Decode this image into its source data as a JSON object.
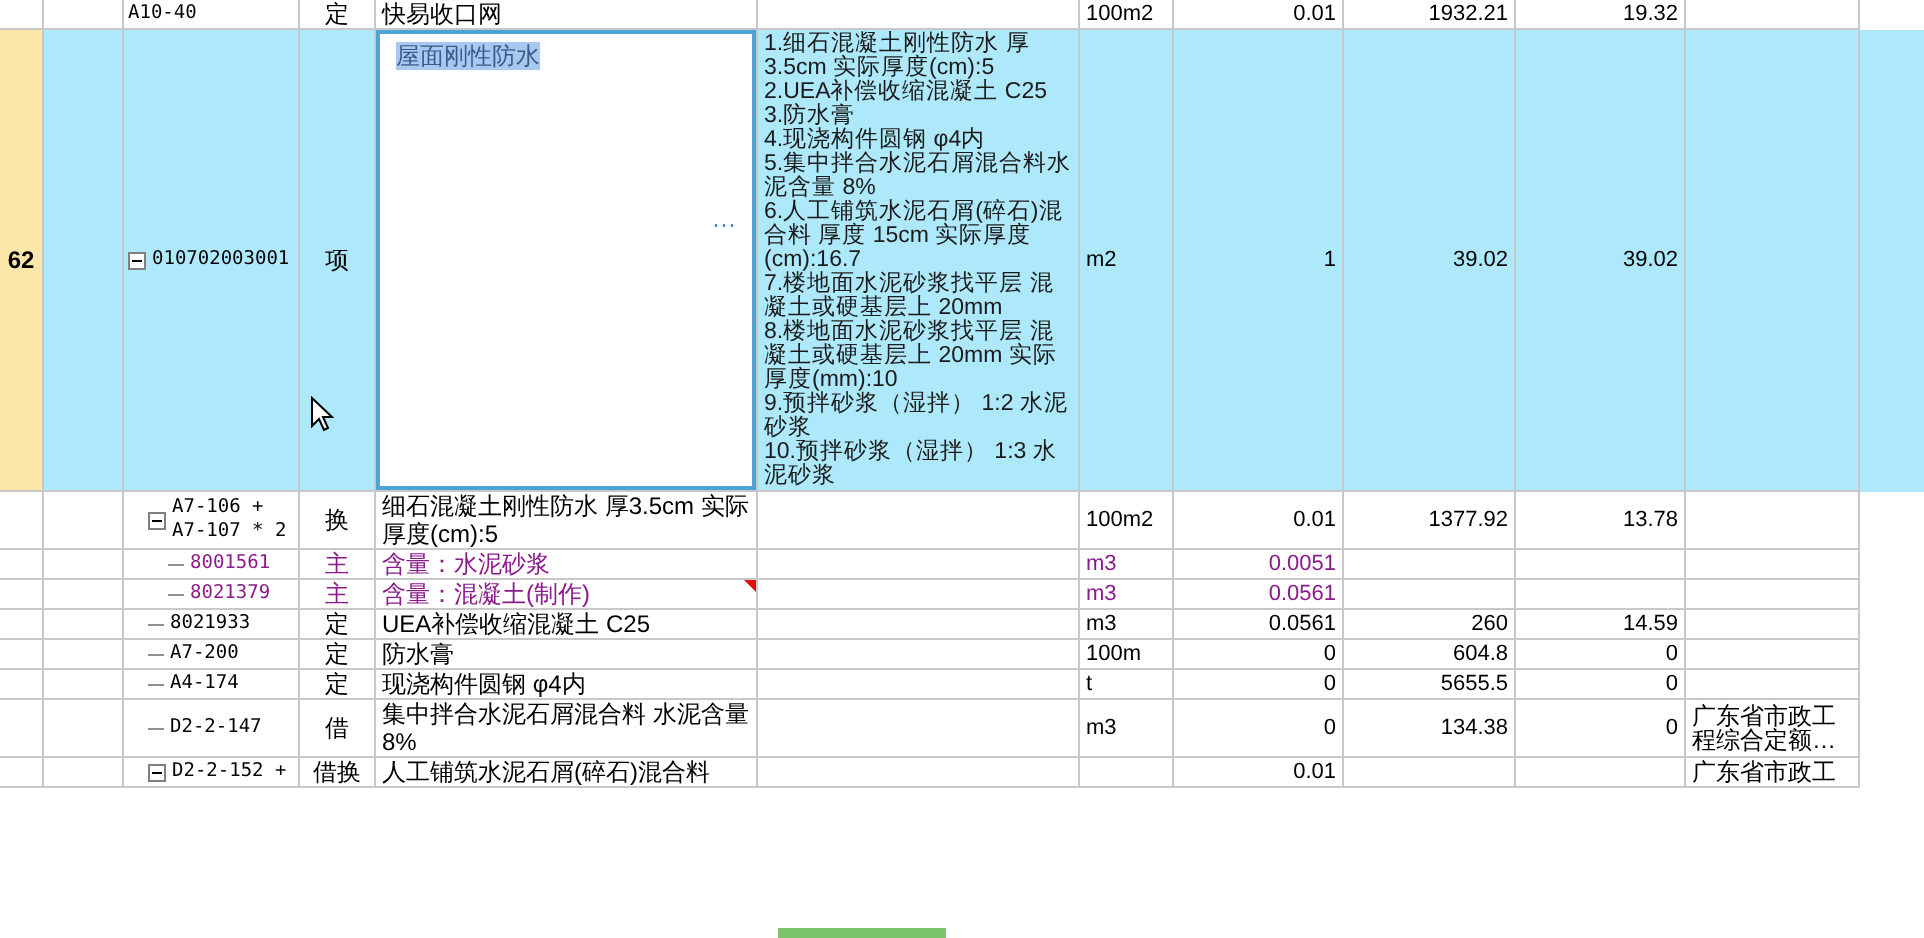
{
  "rows": [
    {
      "number": "",
      "code": "A10-40",
      "type": "定",
      "name": "快易收口网",
      "unit": "100m2",
      "quantity": "0.01",
      "unit_price": "1932.21",
      "total": "19.32",
      "selected": false
    },
    {
      "number": "62",
      "code": "010702003001",
      "type": "项",
      "name": "屋面刚性防水",
      "editor_button": "···",
      "features": [
        "1.细石混凝土刚性防水 厚3.5cm  实际厚度(cm):5",
        "2.UEA补偿收缩混凝土 C25",
        "3.防水膏",
        "4.现浇构件圆钢 φ4内",
        "5.集中拌合水泥石屑混合料水泥含量 8%",
        "6.人工铺筑水泥石屑(碎石)混合料 厚度 15cm  实际厚度(cm):16.7",
        "7.楼地面水泥砂浆找平层 混凝土或硬基层上 20mm",
        "8.楼地面水泥砂浆找平层 混凝土或硬基层上 20mm  实际厚度(mm):10",
        "9.预拌砂浆（湿拌） 1:2 水泥砂浆",
        "10.预拌砂浆（湿拌） 1:3 水泥砂浆"
      ],
      "unit": "m2",
      "quantity": "1",
      "unit_price": "39.02",
      "total": "39.02",
      "selected": true,
      "expanded": true,
      "children": [
        {
          "code": "A7-106 + A7-107 * 2",
          "type": "换",
          "name": "细石混凝土刚性防水 厚3.5cm  实际厚度(cm):5",
          "unit": "100m2",
          "quantity": "0.01",
          "unit_price": "1377.92",
          "total": "13.78",
          "selected": false,
          "expanded": true,
          "children": [
            {
              "kind": "content",
              "code": "8001561",
              "type": "主",
              "name": "含量：水泥砂浆",
              "unit": "m3",
              "quantity": "0.0051",
              "selected": false
            },
            {
              "kind": "content",
              "code": "8021379",
              "type": "主",
              "name": "含量：混凝土(制作)",
              "unit": "m3",
              "quantity": "0.0561",
              "selected": false,
              "has_note": true
            }
          ]
        },
        {
          "code": "8021933",
          "type": "定",
          "name": "UEA补偿收缩混凝土 C25",
          "unit": "m3",
          "quantity": "0.0561",
          "unit_price": "260",
          "total": "14.59",
          "selected": false
        },
        {
          "code": "A7-200",
          "type": "定",
          "name": "防水膏",
          "unit": "100m",
          "quantity": "0",
          "unit_price": "604.8",
          "total": "0",
          "selected": false
        },
        {
          "code": "A4-174",
          "type": "定",
          "name": "现浇构件圆钢 φ4内",
          "unit": "t",
          "quantity": "0",
          "unit_price": "5655.5",
          "total": "0",
          "selected": false
        },
        {
          "code": "D2-2-147",
          "type": "借",
          "name": "集中拌合水泥石屑混合料 水泥含量 8%",
          "unit": "m3",
          "quantity": "0",
          "unit_price": "134.38",
          "total": "0",
          "notes": "广东省市政工程综合定额…",
          "selected": false
        },
        {
          "code": "D2-2-152 +",
          "type": "借换",
          "name": "人工铺筑水泥石屑(碎石)混合料",
          "quantity": "0.01",
          "notes": "广东省市政工",
          "selected": false,
          "expanded": true
        }
      ]
    }
  ]
}
